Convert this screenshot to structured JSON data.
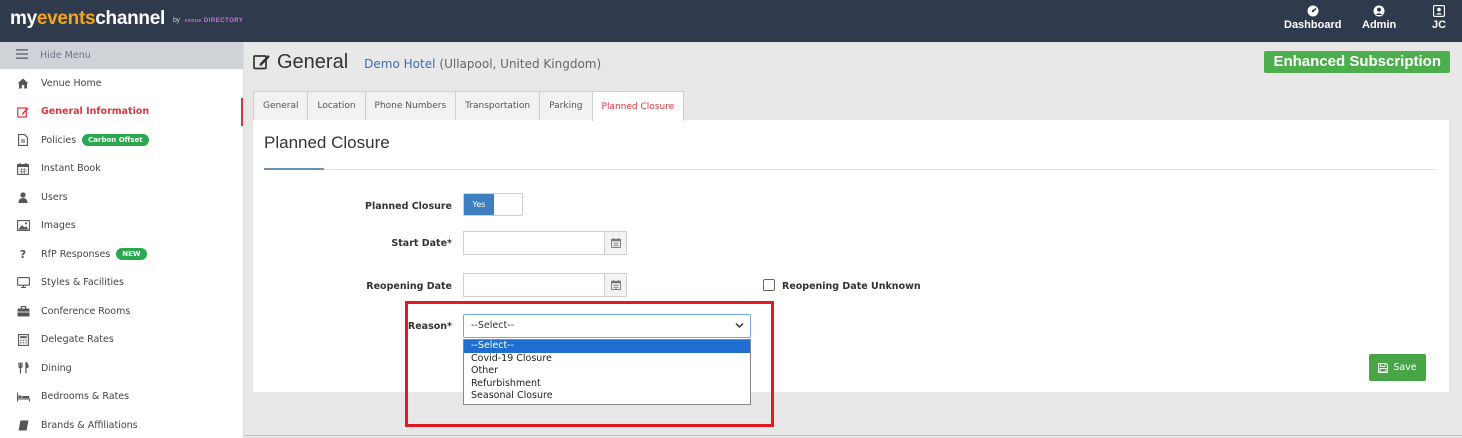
{
  "header": {
    "brand_prefix": "my",
    "brand_accent": "events",
    "brand_suffix": "channel",
    "brand_by": "by",
    "brand_partner_top": "venue",
    "brand_partner": "DIRECTORY",
    "nav": [
      {
        "label": "Dashboard",
        "icon": "dashboard-icon"
      },
      {
        "label": "Admin",
        "icon": "user-circle-icon"
      },
      {
        "label": "JC",
        "icon": "user-square-icon"
      }
    ]
  },
  "sidebar": {
    "hide_menu": "Hide Menu",
    "items": [
      {
        "label": "Venue Home",
        "icon": "home-icon"
      },
      {
        "label": "General Information",
        "icon": "edit-icon",
        "active": true
      },
      {
        "label": "Policies",
        "icon": "document-icon",
        "badge": "Carbon Offset"
      },
      {
        "label": "Instant Book",
        "icon": "calendar-icon"
      },
      {
        "label": "Users",
        "icon": "user-icon"
      },
      {
        "label": "Images",
        "icon": "image-icon"
      },
      {
        "label": "RfP Responses",
        "icon": "question-icon",
        "badge": "NEW"
      },
      {
        "label": "Styles & Facilities",
        "icon": "monitor-icon"
      },
      {
        "label": "Conference Rooms",
        "icon": "briefcase-icon"
      },
      {
        "label": "Delegate Rates",
        "icon": "calculator-icon"
      },
      {
        "label": "Dining",
        "icon": "cutlery-icon"
      },
      {
        "label": "Bedrooms & Rates",
        "icon": "bed-icon"
      },
      {
        "label": "Brands & Affiliations",
        "icon": "book-icon"
      }
    ]
  },
  "page": {
    "title": "General",
    "hotel_name": "Demo Hotel",
    "hotel_location": "(Ullapool, United Kingdom)",
    "subscription": "Enhanced Subscription"
  },
  "tabs": [
    {
      "label": "General"
    },
    {
      "label": "Location"
    },
    {
      "label": "Phone Numbers"
    },
    {
      "label": "Transportation"
    },
    {
      "label": "Parking"
    },
    {
      "label": "Planned Closure",
      "active": true
    }
  ],
  "form": {
    "heading": "Planned Closure",
    "planned_closure_label": "Planned Closure",
    "toggle_value": "Yes",
    "start_date_label": "Start Date*",
    "start_date_value": "",
    "reopening_date_label": "Reopening Date",
    "reopening_date_value": "",
    "reopening_unknown_label": "Reopening Date Unknown",
    "reason_label": "Reason*",
    "reason_selected": "--Select--",
    "reason_options": [
      "--Select--",
      "Covid-19 Closure",
      "Other",
      "Refurbishment",
      "Seasonal Closure"
    ],
    "save_label": "Save"
  },
  "colors": {
    "topbar": "#2f3b4d",
    "brand_accent": "#f4a51e",
    "active_red": "#d9363e",
    "primary_blue": "#3d7fc1",
    "success_green": "#4cae4c",
    "highlight_red": "#e11b22"
  }
}
